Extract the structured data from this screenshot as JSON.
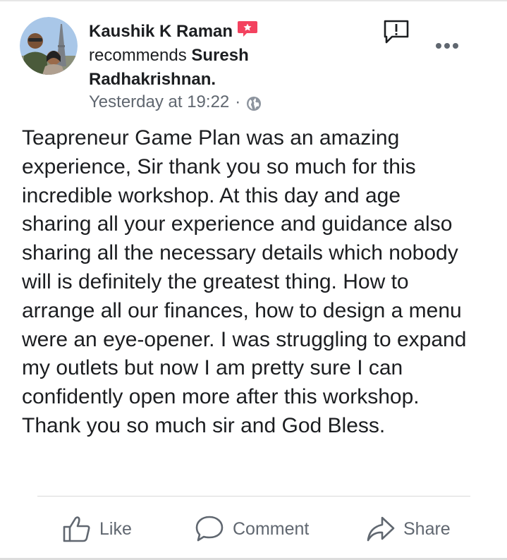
{
  "post": {
    "author": "Kaushik K Raman",
    "verb": "recommends",
    "target_line1": "Suresh",
    "target_line2": "Radhakrishnan.",
    "timestamp": "Yesterday at 19:22",
    "separator": "·",
    "privacy_icon": "globe-icon",
    "badge_icon": "recommendation-star-icon",
    "body": "Teapreneur Game Plan was an amazing experience, Sir thank you so much for this incredible workshop. At this day and age sharing all your experience and guidance also sharing all the necessary details which nobody will is definitely the greatest thing. How to arrange all our finances, how to design a menu were an eye-opener. I was struggling to expand my outlets but now I am pretty sure I can confidently open more after this workshop. Thank you so much sir and God Bless."
  },
  "actions": {
    "like_label": "Like",
    "comment_label": "Comment",
    "share_label": "Share"
  },
  "colors": {
    "text": "#1c1e21",
    "secondary": "#606770",
    "badge": "#f3425f"
  }
}
